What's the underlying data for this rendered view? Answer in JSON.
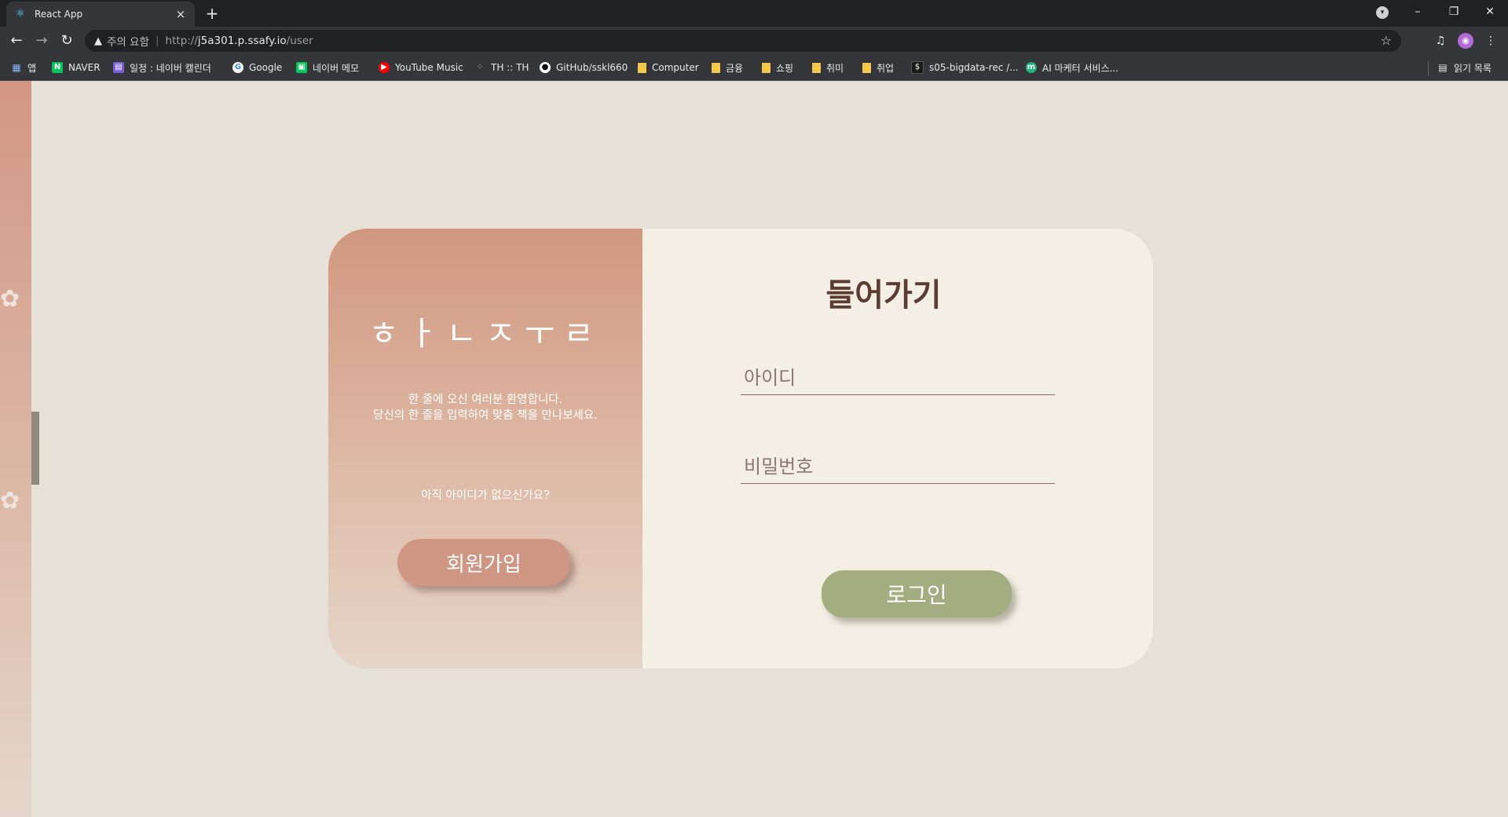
{
  "browser": {
    "tab_title": "React App",
    "tab_close": "×",
    "new_tab": "+",
    "window_controls": {
      "minimize": "–",
      "maximize": "❐",
      "close": "✕"
    },
    "address": {
      "warning": "주의 요함",
      "scheme": "http://",
      "host": "j5a301.p.ssafy.io",
      "path": "/user"
    },
    "bookmarks": [
      {
        "label": "앱",
        "icon": "apps-grid-icon"
      },
      {
        "label": "NAVER",
        "icon": "naver-icon"
      },
      {
        "label": "일정 : 네이버 캘린더",
        "icon": "calendar-icon"
      },
      {
        "label": "Google",
        "icon": "google-icon"
      },
      {
        "label": "네이버 메모",
        "icon": "memo-icon"
      },
      {
        "label": "YouTube Music",
        "icon": "youtube-music-icon"
      },
      {
        "label": "TH :: TH",
        "icon": "dots-icon"
      },
      {
        "label": "GitHub/sskl660",
        "icon": "github-icon"
      },
      {
        "label": "Computer",
        "icon": "folder-icon"
      },
      {
        "label": "금융",
        "icon": "folder-icon"
      },
      {
        "label": "쇼핑",
        "icon": "folder-icon"
      },
      {
        "label": "취미",
        "icon": "folder-icon"
      },
      {
        "label": "취업",
        "icon": "folder-icon"
      },
      {
        "label": "s05-bigdata-rec /...",
        "icon": "terminal-icon"
      },
      {
        "label": "AI 마케터 서비스...",
        "icon": "m-icon"
      }
    ],
    "reading_list": "읽기 목록"
  },
  "page": {
    "brand": "ㅎㅏㄴㅈㅜㄹ",
    "welcome_line1": "한 줄에 오신 여러분 환영합니다.",
    "welcome_line2": "당신의 한 줄을 입력하여 맞춤 책을 만나보세요.",
    "signup_prompt": "아직 아이디가 없으신가요?",
    "signup_button": "회원가입",
    "login_title": "들어가기",
    "id_placeholder": "아이디",
    "password_placeholder": "비밀번호",
    "login_button": "로그인"
  },
  "colors": {
    "page_background": "#e6e1d6",
    "card_right": "#f3efe4",
    "card_left_top": "#d1977f",
    "signup_button": "#cf9684",
    "login_button": "#a3ad80",
    "title_text": "#5c3b33"
  }
}
